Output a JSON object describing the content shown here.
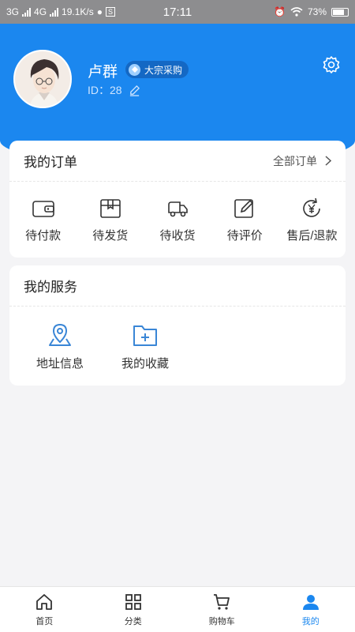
{
  "status_bar": {
    "network_1": "3G",
    "network_2": "4G",
    "speed": "19.1K/s",
    "sim_box": "S",
    "time": "17:11",
    "battery": "73%"
  },
  "profile": {
    "name": "卢群",
    "badge": "大宗采购",
    "id_label": "ID：28",
    "avatar_icon": "avatar-image",
    "settings_icon": "gear-icon"
  },
  "orders": {
    "title": "我的订单",
    "all_label": "全部订单",
    "items": [
      {
        "label": "待付款",
        "icon": "wallet-icon"
      },
      {
        "label": "待发货",
        "icon": "box-icon"
      },
      {
        "label": "待收货",
        "icon": "truck-icon"
      },
      {
        "label": "待评价",
        "icon": "edit-icon"
      },
      {
        "label": "售后/退款",
        "icon": "refund-icon"
      }
    ]
  },
  "services": {
    "title": "我的服务",
    "items": [
      {
        "label": "地址信息",
        "icon": "location-icon"
      },
      {
        "label": "我的收藏",
        "icon": "folder-plus-icon"
      }
    ]
  },
  "tabbar": {
    "items": [
      {
        "label": "首页",
        "icon": "home-icon"
      },
      {
        "label": "分类",
        "icon": "grid-icon"
      },
      {
        "label": "购物车",
        "icon": "cart-icon"
      },
      {
        "label": "我的",
        "icon": "user-icon",
        "active": true
      }
    ],
    "accent": "#1b87ef"
  },
  "colors": {
    "header": "#1b87ef",
    "background": "#f4f4f6",
    "icon_blue": "#3a86d6"
  }
}
